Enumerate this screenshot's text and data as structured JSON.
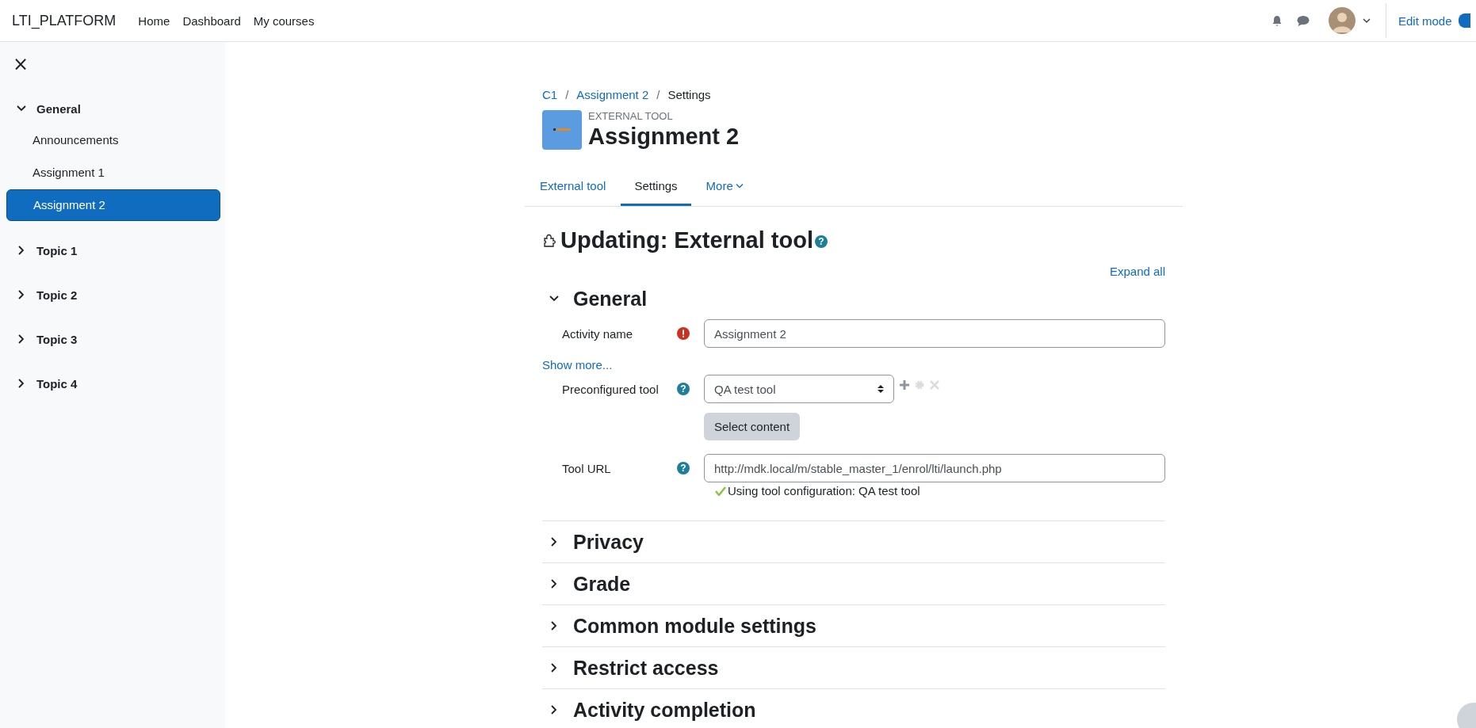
{
  "navbar": {
    "brand": "LTI_PLATFORM",
    "links": [
      "Home",
      "Dashboard",
      "My courses"
    ],
    "edit_mode": "Edit mode",
    "edit_mode_on": true
  },
  "sidebar": {
    "close": "×",
    "items": [
      {
        "label": "General",
        "kind": "section",
        "expanded": true,
        "selected": false,
        "children": [
          {
            "label": "Announcements",
            "kind": "activity",
            "selected": false
          },
          {
            "label": "Assignment 1",
            "kind": "activity",
            "selected": false
          },
          {
            "label": "Assignment 2",
            "kind": "activity",
            "selected": true
          }
        ]
      },
      {
        "label": "Topic 1",
        "kind": "section",
        "expanded": false,
        "selected": false
      },
      {
        "label": "Topic 2",
        "kind": "section",
        "expanded": false,
        "selected": false
      },
      {
        "label": "Topic 3",
        "kind": "section",
        "expanded": false,
        "selected": false
      },
      {
        "label": "Topic 4",
        "kind": "section",
        "expanded": false,
        "selected": false
      }
    ]
  },
  "breadcrumb": [
    {
      "label": "C1",
      "link": true
    },
    {
      "label": "Assignment 2",
      "link": true
    },
    {
      "label": "Settings",
      "link": false
    }
  ],
  "breadcrumb_separator": "/",
  "header": {
    "kicker": "EXTERNAL TOOL",
    "title": "Assignment 2"
  },
  "tabs": [
    {
      "label": "External tool",
      "selected": false,
      "dropdown": false
    },
    {
      "label": "Settings",
      "selected": true,
      "dropdown": false
    },
    {
      "label": "More",
      "selected": false,
      "dropdown": true
    }
  ],
  "page_title": "Updating: External tool",
  "page_title_help": "?",
  "expand_all": "Expand all",
  "sections": [
    {
      "title": "General",
      "expanded": true
    },
    {
      "title": "Privacy",
      "expanded": false
    },
    {
      "title": "Grade",
      "expanded": false
    },
    {
      "title": "Common module settings",
      "expanded": false
    },
    {
      "title": "Restrict access",
      "expanded": false
    },
    {
      "title": "Activity completion",
      "expanded": false
    }
  ],
  "general_form": {
    "fields": [
      {
        "kind": "text",
        "label": "Activity name",
        "required": true,
        "value": "Assignment 2"
      },
      {
        "kind": "link",
        "label": "Show more..."
      },
      {
        "kind": "select",
        "label": "Preconfigured tool",
        "required": false,
        "help": "?",
        "value": "QA test tool"
      },
      {
        "kind": "button",
        "label": "Select content"
      },
      {
        "kind": "text",
        "label": "Tool URL",
        "required": false,
        "help": "?",
        "value": "http://mdk.local/m/stable_master_1/enrol/lti/launch.php",
        "note": "Using tool configuration: QA test tool"
      }
    ]
  }
}
